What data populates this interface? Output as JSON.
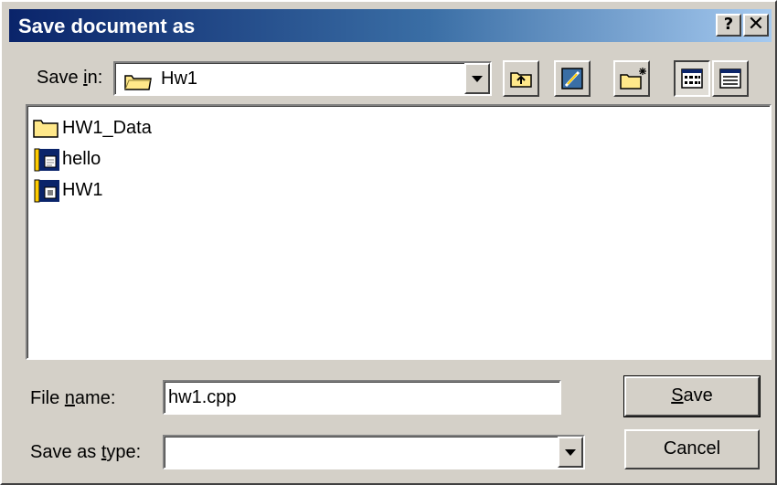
{
  "dialog": {
    "title": "Save document as",
    "help_glyph": "?",
    "close_glyph": "✕"
  },
  "save_in": {
    "label_prefix": "Save ",
    "label_accel": "i",
    "label_suffix": "n:",
    "value": "Hw1",
    "icon": "folder-icon"
  },
  "toolbar": {
    "buttons": [
      {
        "name": "up-one-level",
        "icon": "folder-up-icon"
      },
      {
        "name": "desktop",
        "icon": "desktop-icon"
      },
      {
        "name": "create-new-folder",
        "icon": "new-folder-icon"
      },
      {
        "name": "list-view",
        "icon": "list-view-icon",
        "pressed": true
      },
      {
        "name": "details-view",
        "icon": "details-view-icon"
      }
    ]
  },
  "files": [
    {
      "name": "HW1_Data",
      "icon": "folder-icon"
    },
    {
      "name": "hello",
      "icon": "source-file-icon"
    },
    {
      "name": "HW1",
      "icon": "workspace-file-icon"
    }
  ],
  "file_name": {
    "label_prefix": "File ",
    "label_accel": "n",
    "label_suffix": "ame:",
    "value": "hw1.cpp"
  },
  "save_as_type": {
    "label_prefix": "Save as ",
    "label_accel": "t",
    "label_suffix": "ype:",
    "value": ""
  },
  "buttons": {
    "save_accel": "S",
    "save_rest": "ave",
    "cancel": "Cancel"
  },
  "colors": {
    "face": "#d4d0c8",
    "title_start": "#0a246a",
    "title_end": "#a6caf0",
    "folder": "#ffe88a"
  }
}
